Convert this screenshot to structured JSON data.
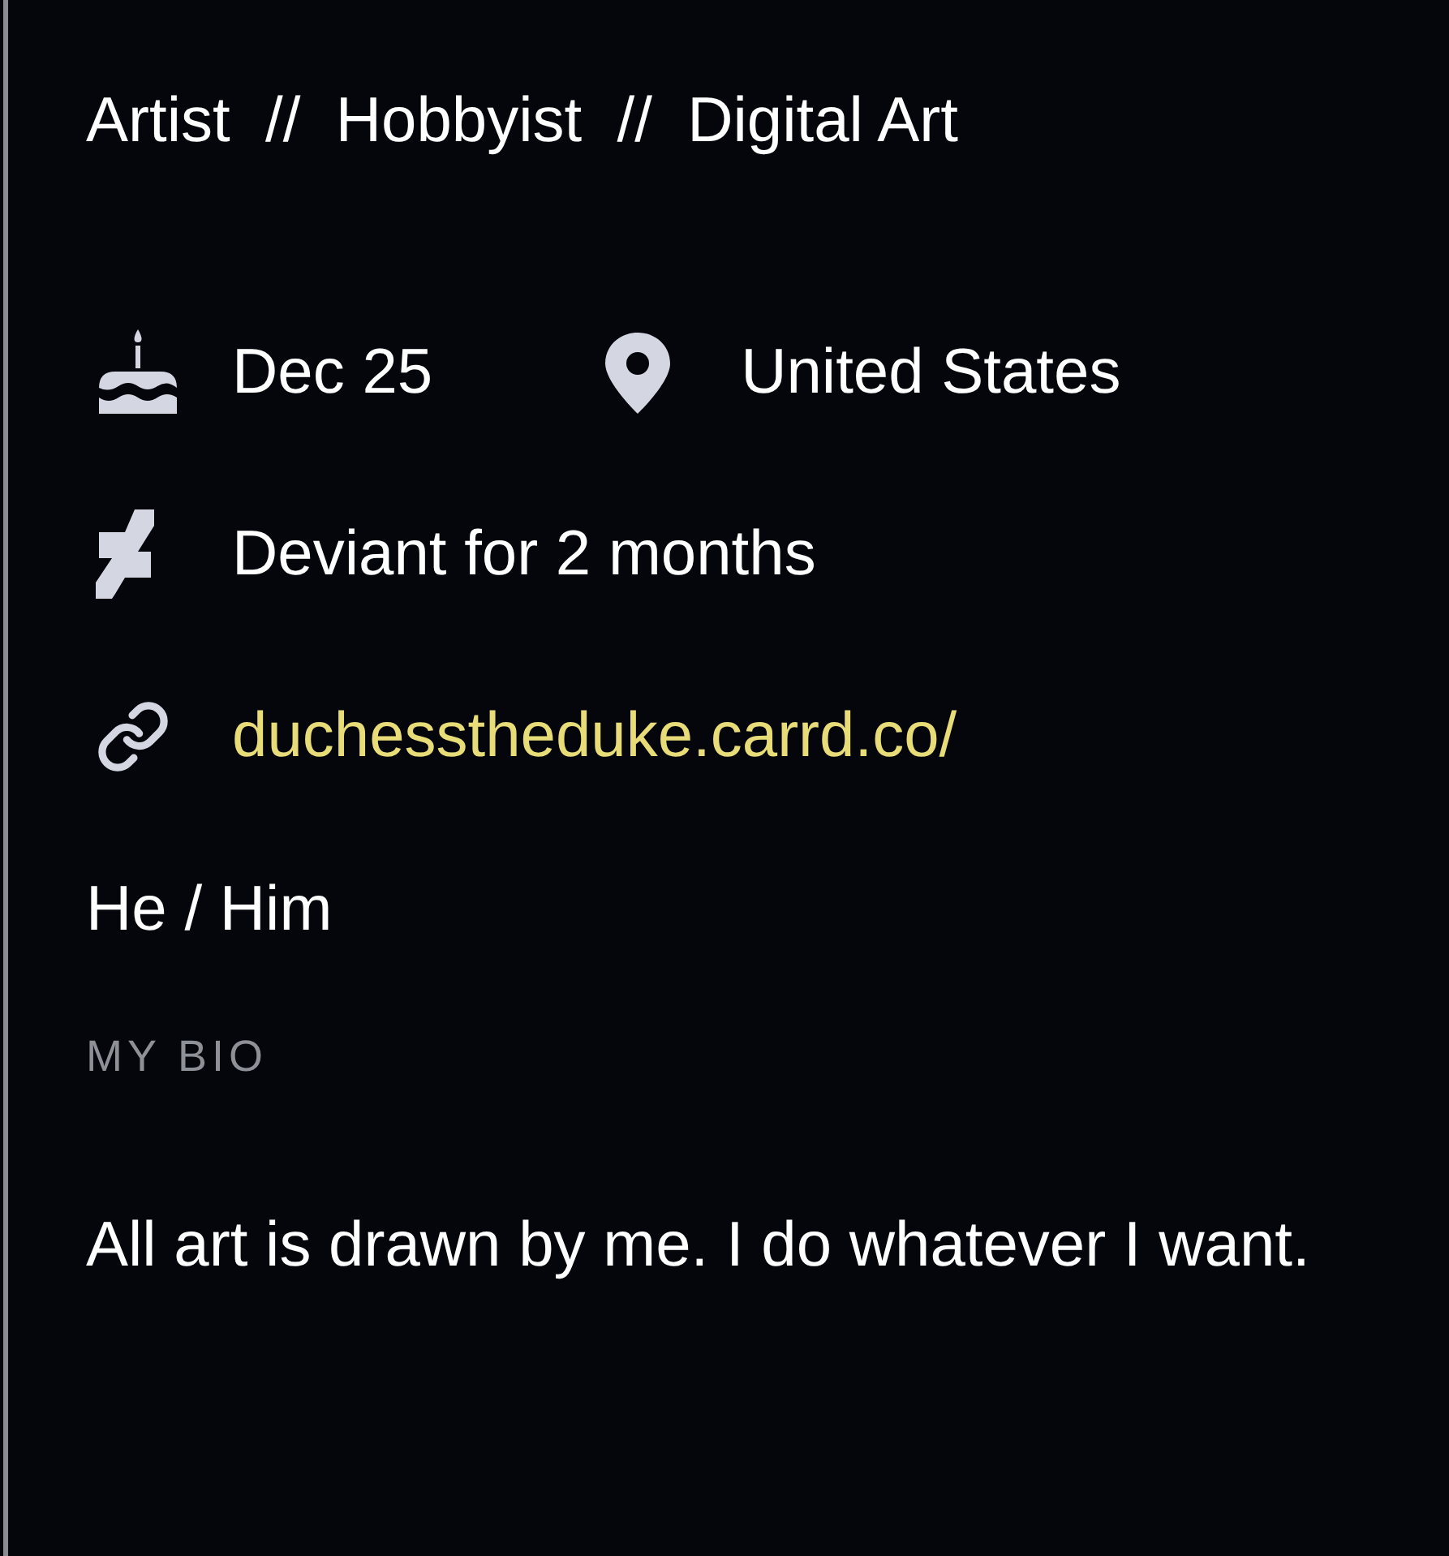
{
  "tagline": "Artist  //  Hobbyist  //  Digital Art",
  "details": [
    {
      "items": [
        {
          "kind": "birthday",
          "text": "Dec 25"
        },
        {
          "kind": "location",
          "text": "United States"
        }
      ]
    },
    {
      "items": [
        {
          "kind": "deviant",
          "text": "Deviant for 2 months"
        }
      ]
    },
    {
      "items": [
        {
          "kind": "link",
          "text": "duchesstheduke.carrd.co/"
        }
      ]
    }
  ],
  "pronouns": "He / Him",
  "bio": {
    "heading": "MY BIO",
    "text": "All art is drawn by me. I do whatever I want."
  }
}
